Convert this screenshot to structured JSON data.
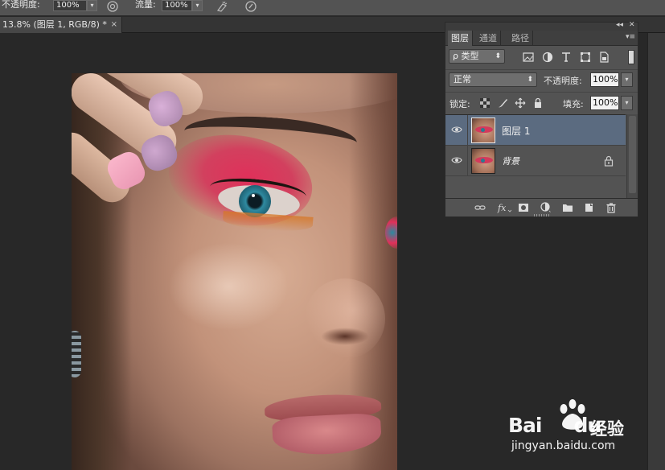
{
  "options_bar": {
    "opacity_label": "不透明度:",
    "opacity_value": "100%",
    "flow_label": "流量:",
    "flow_value": "100%"
  },
  "document_tab": {
    "title": "13.8% (图层 1, RGB/8) *",
    "close": "×"
  },
  "layers_panel": {
    "collapse_glyph": "◂◂",
    "close_glyph": "✕",
    "tabs": [
      {
        "label": "图层",
        "active": true
      },
      {
        "label": "通道",
        "active": false
      },
      {
        "label": "路径",
        "active": false
      }
    ],
    "menu_glyph": "▾≡",
    "kind_filter": "ρ 类型",
    "blend_mode": "正常",
    "opacity_label": "不透明度:",
    "opacity_value": "100%",
    "lock_label": "锁定:",
    "fill_label": "填充:",
    "fill_value": "100%",
    "layers": [
      {
        "name": "图层 1",
        "selected": true,
        "locked": false
      },
      {
        "name": "背景",
        "selected": false,
        "locked": true
      }
    ]
  },
  "watermark": {
    "brand": "Bai",
    "brand2": "du",
    "cn": "经验",
    "url": "jingyan.baidu.com"
  },
  "colors": {
    "panel_bg": "#535353",
    "selected_layer": "#5b6b80",
    "canvas_bg": "#282828"
  }
}
